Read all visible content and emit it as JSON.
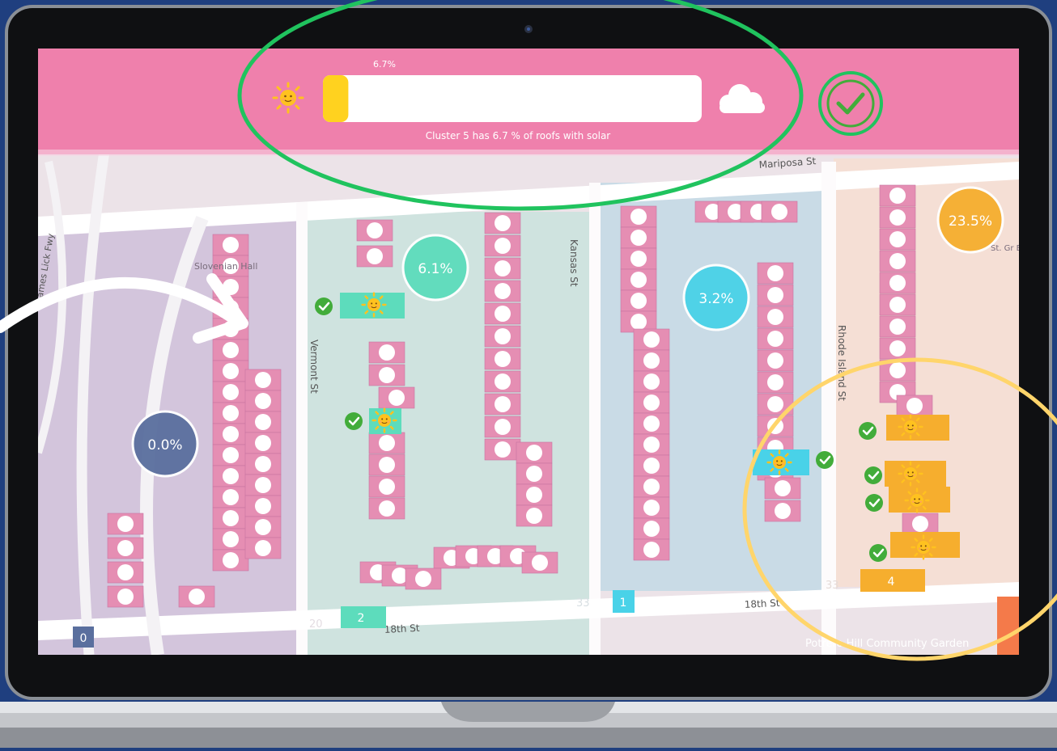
{
  "hud": {
    "progress_label": "6.7%",
    "progress_fraction": 0.067,
    "caption": "Cluster 5 has 6.7 % of roofs with solar",
    "sun_icon": "sun-face-icon",
    "cloud_icon": "cloud-icon",
    "confirm_icon": "check-circle-icon"
  },
  "map": {
    "streets": {
      "mariposa": "Mariposa St",
      "kansas": "Kansas St",
      "vermont": "Vermont St",
      "rhode_island": "Rhode Island St",
      "james_lick": "James Lick Fwy",
      "eighteenth_a": "18th St",
      "eighteenth_b": "18th St"
    },
    "places": {
      "slovenian_hall": "Slovenian Hall",
      "st_gregory": "St. Gr Episcop",
      "potrero": "Potrero Hill Community Garden"
    },
    "addresses": {
      "a20": "20",
      "a33a": "33",
      "a33b": "33"
    },
    "clusters": [
      {
        "id": "0",
        "percent": "0.0%",
        "color": "#5a6f9e"
      },
      {
        "id": "2",
        "percent": "6.1%",
        "color": "#5ddcbc"
      },
      {
        "id": "1",
        "percent": "3.2%",
        "color": "#49d2e8"
      },
      {
        "id": "4",
        "percent": "23.5%",
        "color": "#f6ae2e"
      }
    ]
  },
  "colors": {
    "header_bg": "#ef80ac",
    "progress_fill": "#ffd21f",
    "highlight_green": "#20c35e",
    "highlight_yellow": "#ffd56b",
    "checkmark": "#42ac3a",
    "roof_pink": "#e58eb3",
    "roof_dark": "#d28aac",
    "sun": "#ffc21f"
  }
}
